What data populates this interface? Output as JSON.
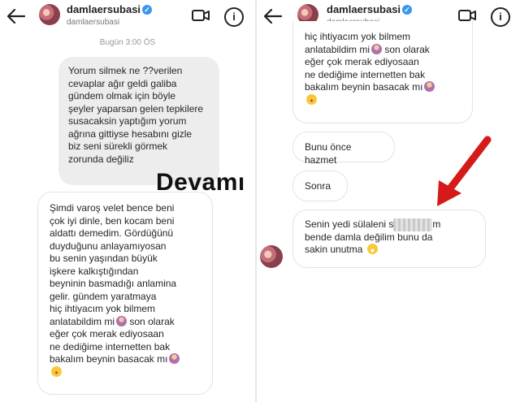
{
  "header": {
    "username": "damlaersubasi",
    "handle": "damlaersubasi",
    "icons": [
      "back-arrow-icon",
      "avatar",
      "verified-badge-icon",
      "video-camera-icon",
      "info-icon"
    ]
  },
  "left": {
    "timestamp": "Bugün 3:00 ÖS",
    "outgoing_message": "Yorum silmek ne ??verilen\ncevaplar ağır geldi galiba\ngündem olmak için böyle\nşeyler yaparsan gelen tepkilere\nsusacaksin  yaptığım yorum\nağrına gittiyse hesabını gizle\nbiz seni sürekli görmek\nzorunda değiliz",
    "incoming_message": {
      "text": "Şimdi varoş velet bence beni\nçok iyi dinle, ben kocam beni\naldattı demedim. Gördüğünü\nduyduğunu anlayamıyosan\nbu senin yaşından büyük\nişkere kalkıştığından\nbeyninin basmadığı anlamina\ngelir. gündem yaratmaya\nhiç ihtiyacım yok bilmem\nanlatabildim mi",
      "text_2": " son olarak\neğer çok merak ediyosaan\nne dediğime internetten bak\nbakalım beynin basacak mı",
      "emoji_1": "woman-shrugging-emoji",
      "emoji_2": "woman-shrugging-emoji",
      "emoji_3": "face-blowing-kiss-emoji"
    },
    "overlay_text": "Devamı"
  },
  "right": {
    "top_message": {
      "line_1": "hiç ihtiyacım yok bilmem\nanlatabildim mi",
      "line_2": " son olarak\neğer çok merak ediyosaan\nne dediğime internetten bak\nbakalım beynin basacak mı",
      "emoji_1": "woman-shrugging-emoji",
      "emoji_2": "woman-shrugging-emoji",
      "emoji_3": "face-blowing-kiss-emoji"
    },
    "message_2": "Bunu önce hazmet",
    "message_3": "Sonra",
    "message_4": {
      "part_1": "Senin yedi sülaleni s",
      "blurred": "",
      "part_2": "m\nbende damla değilim bunu da\nsakin unutma ",
      "emoji": "face-with-tears-of-joy-emoji"
    },
    "annotation": "red-arrow"
  },
  "colors": {
    "verified": "#3897f0",
    "outgoing_bubble": "#ededed",
    "arrow": "#d61a1a"
  }
}
